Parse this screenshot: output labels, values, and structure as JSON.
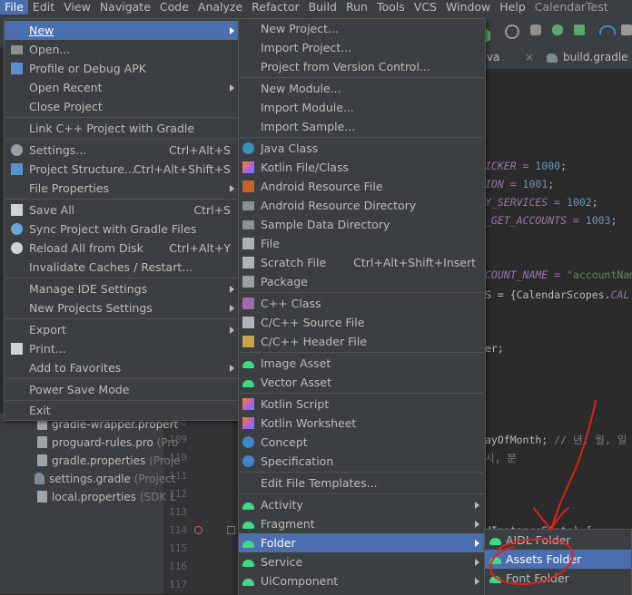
{
  "menubar": {
    "items": [
      "File",
      "Edit",
      "View",
      "Navigate",
      "Code",
      "Analyze",
      "Refactor",
      "Build",
      "Run",
      "Tools",
      "VCS",
      "Window",
      "Help"
    ],
    "project_title": "CalendarTest"
  },
  "editor_tabs": [
    "ity.java",
    "build.gradle (:"
  ],
  "code_lines": [
    {
      "pre": "ICKER = ",
      "num": "1000",
      ";": ";"
    },
    {
      "pre": "ION = ",
      "num": "1001"
    },
    {
      "pre": "_SERVICES = ",
      "num": "1002"
    },
    {
      "pre": "GET_ACCOUNTS = ",
      "num": "1003"
    }
  ],
  "code_text": {
    "l1": "ICKER = ",
    "n1": "1000",
    "l2": "ION = ",
    "n2": "1001",
    "l3": "Y_SERVICES = ",
    "n3": "1002",
    "l4": "_GET_ACCOUNTS = ",
    "n4": "1003",
    "l5a": "COUNT_NAME = ",
    "l5s": "\"accountNam",
    "l6a": "S = {CalendarScopes.",
    "l6f": "CAL",
    "l7": "er;",
    "l8a": "ayOfMonth; ",
    "l8c": "// 년, 월, 일",
    "l9c": "시, 분",
    "l10": "dInstanceState) {"
  },
  "gutter_lines": [
    "108",
    "109",
    "110",
    "111",
    "112",
    "113",
    "114",
    "115",
    "116",
    "117"
  ],
  "tree": [
    {
      "label": "gradle-wrapper.propert",
      "sub": ""
    },
    {
      "label": "proguard-rules.pro",
      "sub": "(Pro"
    },
    {
      "label": "gradle.properties",
      "sub": "(Proje"
    },
    {
      "label": "settings.gradle",
      "sub": "(Project"
    },
    {
      "label": "local.properties",
      "sub": "(SDK L"
    }
  ],
  "file_menu": {
    "items": [
      {
        "label": "New",
        "shortcut": "",
        "submenu": true
      },
      {
        "label": "Open...",
        "shortcut": "",
        "submenu": false
      },
      {
        "label": "Profile or Debug APK",
        "shortcut": "",
        "submenu": false
      },
      {
        "label": "Open Recent",
        "shortcut": "",
        "submenu": true
      },
      {
        "label": "Close Project",
        "shortcut": "",
        "submenu": false
      },
      {
        "label": "Link C++ Project with Gradle",
        "shortcut": "",
        "submenu": false
      },
      {
        "label": "Settings...",
        "shortcut": "Ctrl+Alt+S",
        "submenu": false
      },
      {
        "label": "Project Structure...",
        "shortcut": "Ctrl+Alt+Shift+S",
        "submenu": false
      },
      {
        "label": "File Properties",
        "shortcut": "",
        "submenu": true
      },
      {
        "label": "Save All",
        "shortcut": "Ctrl+S",
        "submenu": false
      },
      {
        "label": "Sync Project with Gradle Files",
        "shortcut": "",
        "submenu": false
      },
      {
        "label": "Reload All from Disk",
        "shortcut": "Ctrl+Alt+Y",
        "submenu": false
      },
      {
        "label": "Invalidate Caches / Restart...",
        "shortcut": "",
        "submenu": false
      },
      {
        "label": "Manage IDE Settings",
        "shortcut": "",
        "submenu": true
      },
      {
        "label": "New Projects Settings",
        "shortcut": "",
        "submenu": true
      },
      {
        "label": "Export",
        "shortcut": "",
        "submenu": true
      },
      {
        "label": "Print...",
        "shortcut": "",
        "submenu": false
      },
      {
        "label": "Add to Favorites",
        "shortcut": "",
        "submenu": true
      },
      {
        "label": "Power Save Mode",
        "shortcut": "",
        "submenu": false
      },
      {
        "label": "Exit",
        "shortcut": "",
        "submenu": false
      }
    ]
  },
  "new_menu": {
    "items": [
      {
        "label": "New Project..."
      },
      {
        "label": "Import Project..."
      },
      {
        "label": "Project from Version Control..."
      },
      {
        "label": "New Module..."
      },
      {
        "label": "Import Module..."
      },
      {
        "label": "Import Sample..."
      },
      {
        "label": "Java Class"
      },
      {
        "label": "Kotlin File/Class"
      },
      {
        "label": "Android Resource File"
      },
      {
        "label": "Android Resource Directory"
      },
      {
        "label": "Sample Data Directory"
      },
      {
        "label": "File"
      },
      {
        "label": "Scratch File",
        "shortcut": "Ctrl+Alt+Shift+Insert"
      },
      {
        "label": "Package"
      },
      {
        "label": "C++ Class"
      },
      {
        "label": "C/C++ Source File"
      },
      {
        "label": "C/C++ Header File"
      },
      {
        "label": "Image Asset"
      },
      {
        "label": "Vector Asset"
      },
      {
        "label": "Kotlin Script"
      },
      {
        "label": "Kotlin Worksheet"
      },
      {
        "label": "Concept"
      },
      {
        "label": "Specification"
      },
      {
        "label": "Edit File Templates..."
      },
      {
        "label": "Activity"
      },
      {
        "label": "Fragment"
      },
      {
        "label": "Folder"
      },
      {
        "label": "Service"
      },
      {
        "label": "UiComponent"
      }
    ]
  },
  "folder_menu": {
    "items": [
      {
        "label": "AIDL Folder"
      },
      {
        "label": "Assets Folder"
      },
      {
        "label": "Font Folder"
      }
    ]
  },
  "colors": {
    "selection": "#4b6eaf",
    "menu_bg": "#3c3f41",
    "annotation": "#e0201b"
  }
}
